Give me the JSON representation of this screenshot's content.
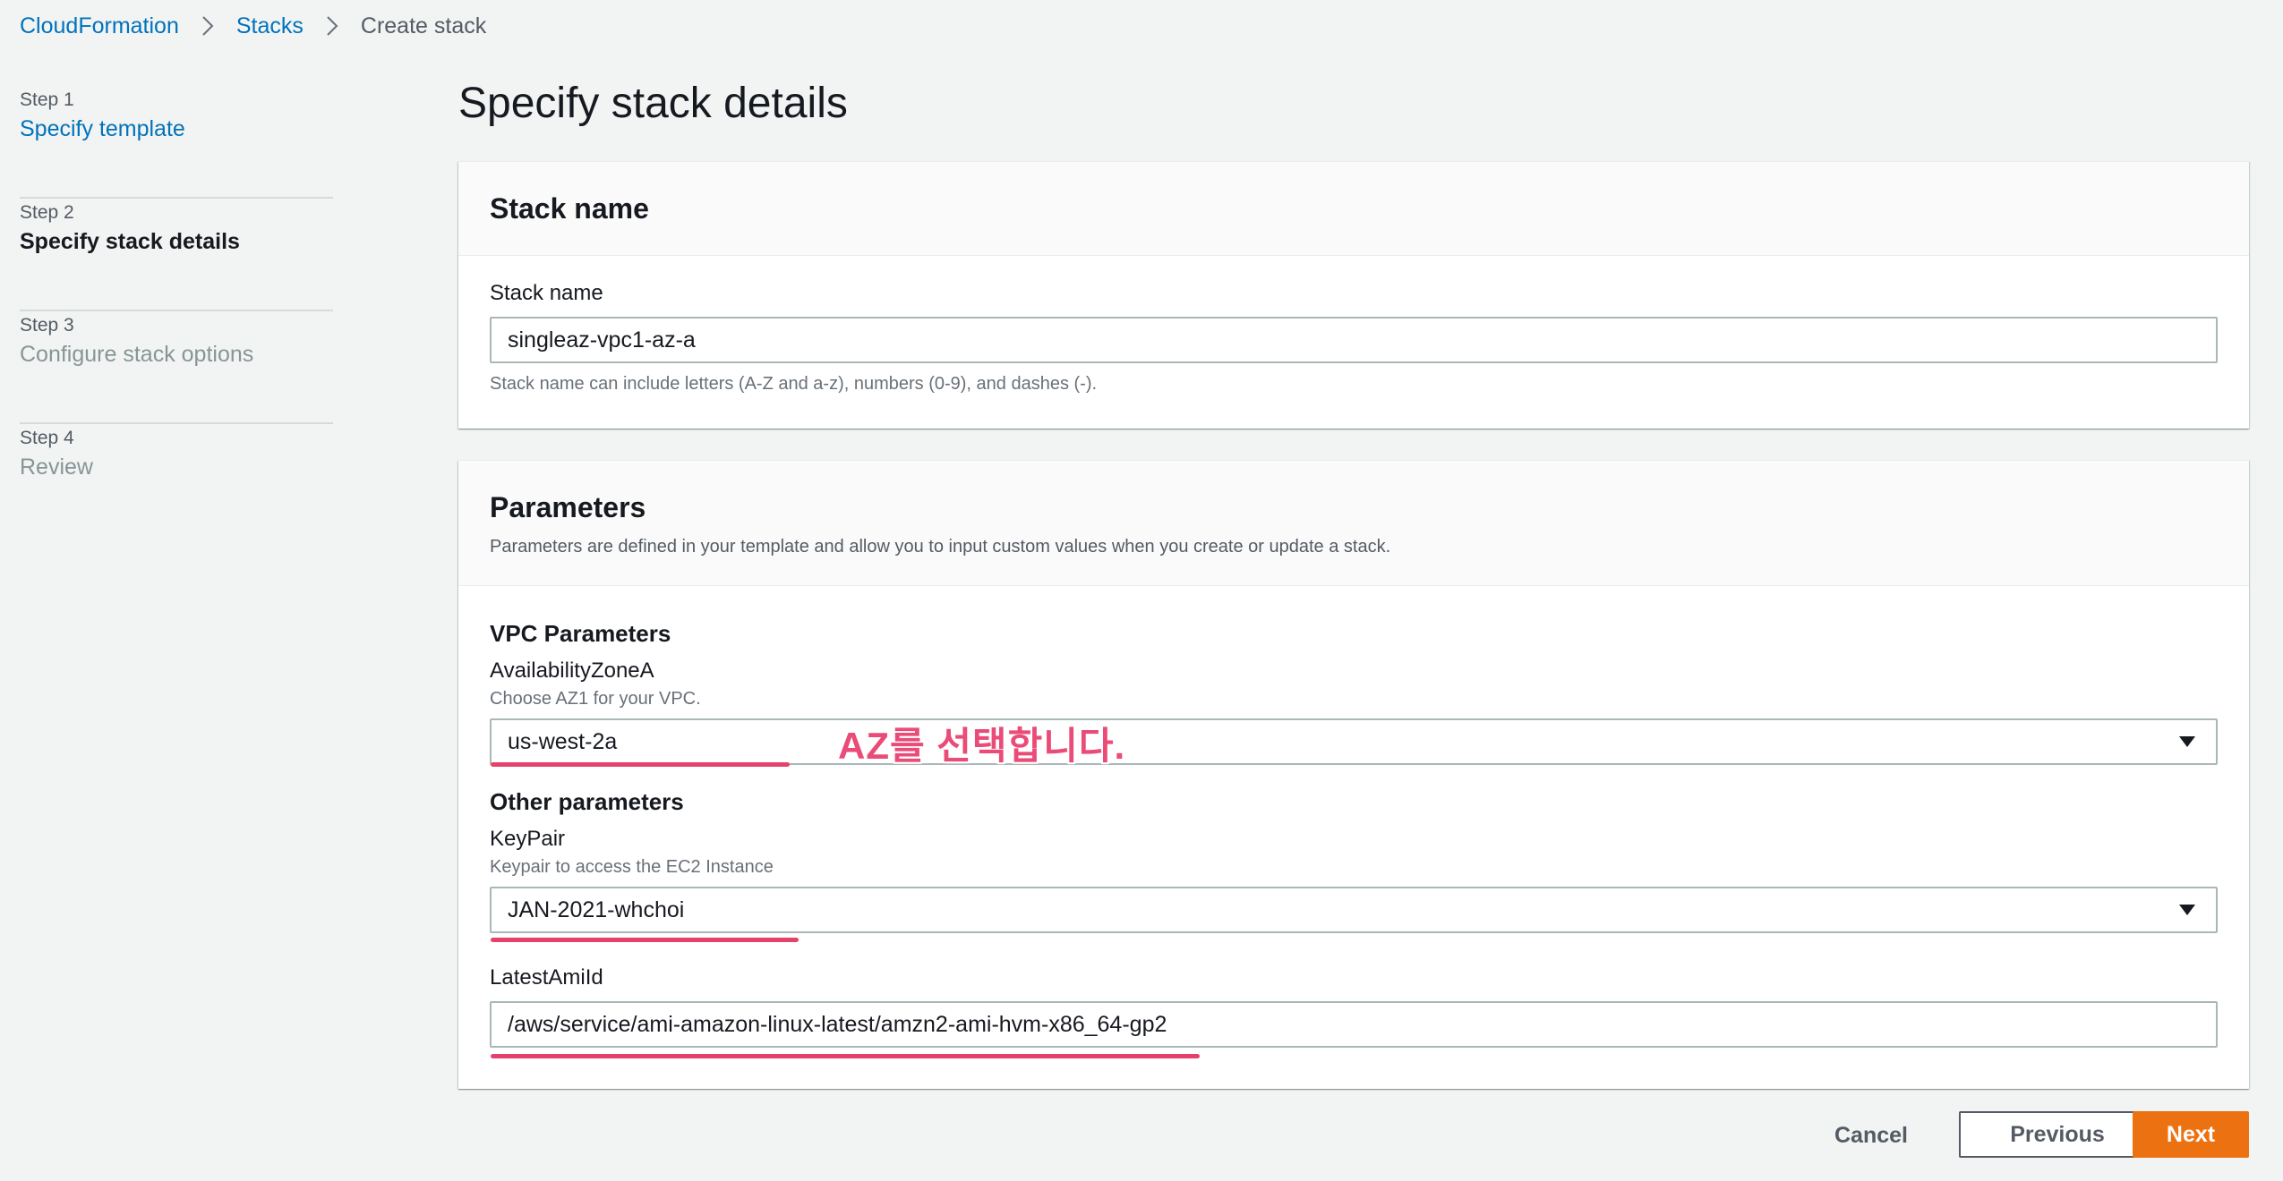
{
  "breadcrumb": {
    "items": [
      "CloudFormation",
      "Stacks",
      "Create stack"
    ]
  },
  "steps": [
    {
      "number": "Step 1",
      "title": "Specify template"
    },
    {
      "number": "Step 2",
      "title": "Specify stack details"
    },
    {
      "number": "Step 3",
      "title": "Configure stack options"
    },
    {
      "number": "Step 4",
      "title": "Review"
    }
  ],
  "page_title": "Specify stack details",
  "stack_name_panel": {
    "title": "Stack name",
    "label": "Stack name",
    "value": "singleaz-vpc1-az-a",
    "help": "Stack name can include letters (A-Z and a-z), numbers (0-9), and dashes (-)."
  },
  "parameters_panel": {
    "title": "Parameters",
    "description": "Parameters are defined in your template and allow you to input custom values when you create or update a stack.",
    "vpc_group": "VPC Parameters",
    "az_label": "AvailabilityZoneA",
    "az_desc": "Choose AZ1 for your VPC.",
    "az_value": "us-west-2a",
    "other_group": "Other parameters",
    "keypair_label": "KeyPair",
    "keypair_desc": "Keypair to access the EC2 Instance",
    "keypair_value": "JAN-2021-whchoi",
    "ami_label": "LatestAmiId",
    "ami_value": "/aws/service/ami-amazon-linux-latest/amzn2-ami-hvm-x86_64-gp2"
  },
  "annotation": "AZ를 선택합니다.",
  "footer": {
    "cancel": "Cancel",
    "previous": "Previous",
    "next": "Next"
  },
  "colors": {
    "link": "#0073bb",
    "primary_button": "#ec7211",
    "annotation": "#ea4b77"
  }
}
